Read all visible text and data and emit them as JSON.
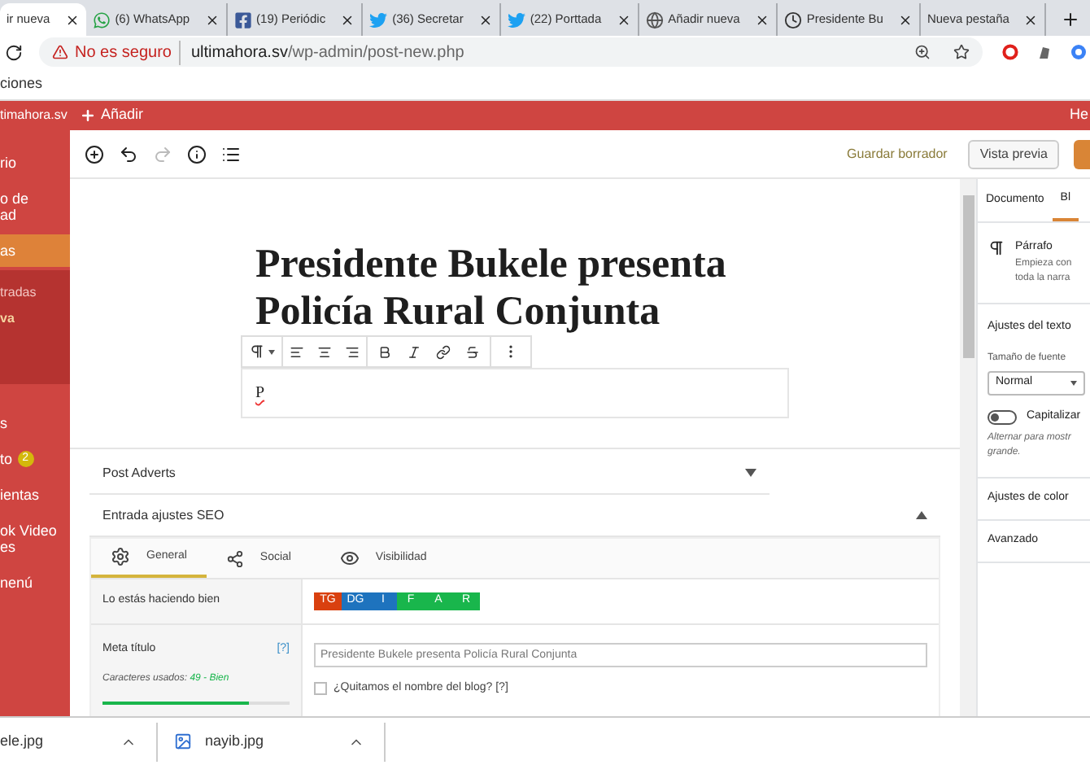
{
  "browser": {
    "tabs": [
      {
        "label": "ir nueva",
        "kind": "none",
        "selected": true
      },
      {
        "label": "(6) WhatsApp",
        "kind": "whatsapp",
        "selected": false
      },
      {
        "label": "(19) Periódic",
        "kind": "facebook",
        "selected": false
      },
      {
        "label": "(36) Secretar",
        "kind": "twitter",
        "selected": false
      },
      {
        "label": "(22) Porttada",
        "kind": "twitter",
        "selected": false
      },
      {
        "label": "Añadir nueva",
        "kind": "globe",
        "selected": false
      },
      {
        "label": "Presidente Bu",
        "kind": "clock",
        "selected": false
      },
      {
        "label": "Nueva pestaña",
        "kind": "none",
        "selected": false
      }
    ],
    "security": "No es seguro",
    "url_host": "ultimahora.sv",
    "url_path": "/wp-admin/post-new.php",
    "bookmark": "ciones"
  },
  "admin_bar": {
    "site": "timahora.sv",
    "add": "Añadir",
    "right": "He"
  },
  "sidebar": {
    "items": [
      {
        "label": "rio",
        "selected": false
      },
      {
        "label": "o de\nad",
        "selected": false
      },
      {
        "label": "as",
        "selected": true,
        "children": [
          {
            "label": "tradas",
            "selected": false
          },
          {
            "label": "va",
            "selected": true
          }
        ]
      },
      {
        "label": "s",
        "selected": false
      },
      {
        "label": "to",
        "badge": "2",
        "selected": false
      },
      {
        "label": "ientas",
        "selected": false
      },
      {
        "label": "ok Video\nes",
        "selected": false
      },
      {
        "label": "nenú",
        "selected": false
      }
    ]
  },
  "editor": {
    "save_draft": "Guardar borrador",
    "preview": "Vista previa",
    "title": "Presidente Bukele presenta Policía Rural Conjunta",
    "paragraph": "P",
    "meta_boxes": [
      {
        "title": "Post Adverts",
        "expanded": false
      },
      {
        "title": "Entrada ajustes SEO",
        "expanded": true
      }
    ],
    "seo": {
      "tabs": [
        {
          "label": "General",
          "kind": "gear",
          "selected": true
        },
        {
          "label": "Social",
          "kind": "share",
          "selected": false
        },
        {
          "label": "Visibilidad",
          "kind": "eye",
          "selected": false
        }
      ],
      "score_label": "Lo estás haciendo bien",
      "badges": [
        {
          "label": "TG",
          "color": "#d9400f"
        },
        {
          "label": "DG",
          "color": "#1e73be"
        },
        {
          "label": "I",
          "color": "#1e73be"
        },
        {
          "label": "F",
          "color": "#19b64c"
        },
        {
          "label": "A",
          "color": "#19b64c"
        },
        {
          "label": "R",
          "color": "#19b64c"
        }
      ],
      "meta_title": {
        "label": "Meta título",
        "help": "[?]",
        "count_label": "Caracteres usados:",
        "count": "49 - Bien",
        "level": 0.78,
        "placeholder": "Presidente Bukele presenta Policía Rural Conjunta"
      },
      "checkbox": {
        "label": "¿Quitamos el nombre del blog? [?]",
        "checked": false
      }
    }
  },
  "settings": {
    "tabs": [
      {
        "label": "Documento",
        "selected": false
      },
      {
        "label": "Bl",
        "selected": true
      }
    ],
    "block_name": "Párrafo",
    "block_desc": [
      "Empieza con",
      "toda la narra"
    ],
    "text_settings": "Ajustes del texto",
    "font_size_label": "Tamaño de fuente",
    "font_size": "Normal",
    "toggle": {
      "label": "Capitalizar",
      "on": false
    },
    "toggle_help": [
      "Alternar para mostr",
      "grande."
    ],
    "sections": [
      "Ajustes de color",
      "Avanzado"
    ]
  },
  "downloads": [
    {
      "name": "ele.jpg"
    },
    {
      "name": "nayib.jpg"
    }
  ]
}
